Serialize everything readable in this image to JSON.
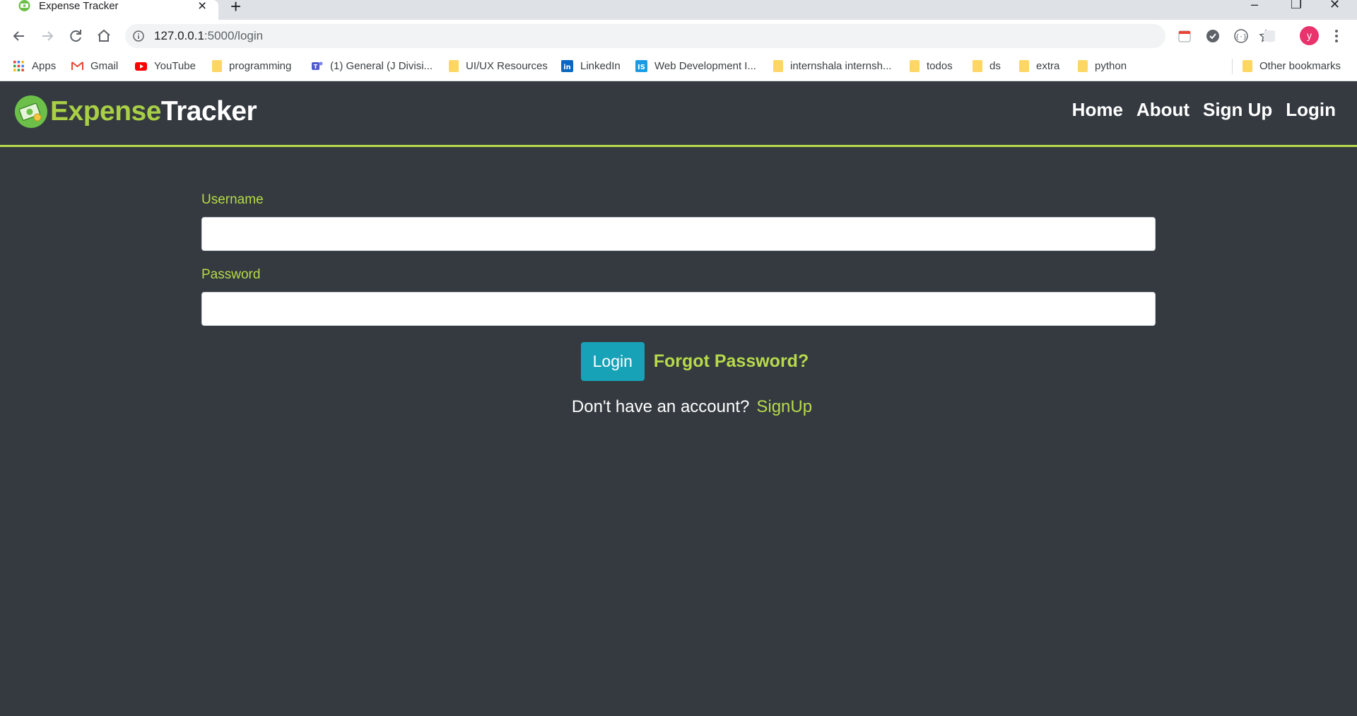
{
  "browser": {
    "tab_title": "Expense Tracker",
    "url_host": "127.0.0.1",
    "url_rest": ":5000/login",
    "profile_initial": "y",
    "bookmarks": [
      {
        "label": "Apps",
        "icon": "apps-grid-icon"
      },
      {
        "label": "Gmail",
        "icon": "gmail-icon"
      },
      {
        "label": "YouTube",
        "icon": "youtube-icon"
      },
      {
        "label": "programming",
        "icon": "folder-icon"
      },
      {
        "label": "(1) General (J Divisi...",
        "icon": "teams-icon"
      },
      {
        "label": "UI/UX Resources",
        "icon": "folder-icon"
      },
      {
        "label": "LinkedIn",
        "icon": "linkedin-icon"
      },
      {
        "label": "Web Development I...",
        "icon": "is-icon"
      },
      {
        "label": "internshala internsh...",
        "icon": "folder-icon"
      },
      {
        "label": "todos",
        "icon": "folder-icon"
      },
      {
        "label": "ds",
        "icon": "folder-icon"
      },
      {
        "label": "extra",
        "icon": "folder-icon"
      },
      {
        "label": "python",
        "icon": "folder-icon"
      }
    ],
    "other_bookmarks": "Other bookmarks",
    "colors": {
      "accent": "#b8d94b",
      "background": "#343a40",
      "button": "#17a2b8"
    }
  },
  "app": {
    "brand_part1": "Expense",
    "brand_part2": "Tracker",
    "nav": [
      "Home",
      "About",
      "Sign Up",
      "Login"
    ],
    "form": {
      "username_label": "Username",
      "username_value": "",
      "password_label": "Password",
      "password_value": "",
      "login_button": "Login",
      "forgot_link": "Forgot Password?",
      "no_account_text": "Don't have an account?",
      "signup_link": "SignUp"
    }
  }
}
